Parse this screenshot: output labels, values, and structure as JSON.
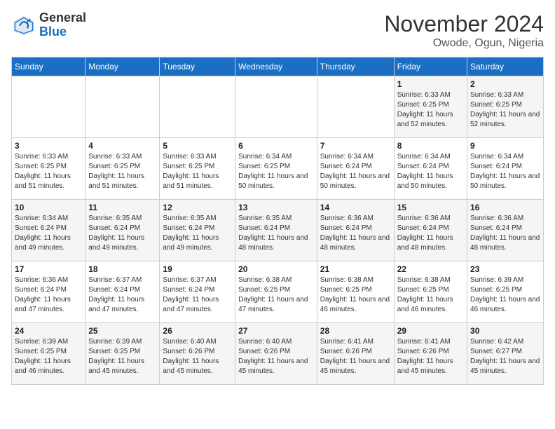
{
  "logo": {
    "general": "General",
    "blue": "Blue"
  },
  "title": "November 2024",
  "location": "Owode, Ogun, Nigeria",
  "days_header": [
    "Sunday",
    "Monday",
    "Tuesday",
    "Wednesday",
    "Thursday",
    "Friday",
    "Saturday"
  ],
  "weeks": [
    [
      {
        "day": "",
        "sunrise": "",
        "sunset": "",
        "daylight": ""
      },
      {
        "day": "",
        "sunrise": "",
        "sunset": "",
        "daylight": ""
      },
      {
        "day": "",
        "sunrise": "",
        "sunset": "",
        "daylight": ""
      },
      {
        "day": "",
        "sunrise": "",
        "sunset": "",
        "daylight": ""
      },
      {
        "day": "",
        "sunrise": "",
        "sunset": "",
        "daylight": ""
      },
      {
        "day": "1",
        "sunrise": "Sunrise: 6:33 AM",
        "sunset": "Sunset: 6:25 PM",
        "daylight": "Daylight: 11 hours and 52 minutes."
      },
      {
        "day": "2",
        "sunrise": "Sunrise: 6:33 AM",
        "sunset": "Sunset: 6:25 PM",
        "daylight": "Daylight: 11 hours and 52 minutes."
      }
    ],
    [
      {
        "day": "3",
        "sunrise": "Sunrise: 6:33 AM",
        "sunset": "Sunset: 6:25 PM",
        "daylight": "Daylight: 11 hours and 51 minutes."
      },
      {
        "day": "4",
        "sunrise": "Sunrise: 6:33 AM",
        "sunset": "Sunset: 6:25 PM",
        "daylight": "Daylight: 11 hours and 51 minutes."
      },
      {
        "day": "5",
        "sunrise": "Sunrise: 6:33 AM",
        "sunset": "Sunset: 6:25 PM",
        "daylight": "Daylight: 11 hours and 51 minutes."
      },
      {
        "day": "6",
        "sunrise": "Sunrise: 6:34 AM",
        "sunset": "Sunset: 6:25 PM",
        "daylight": "Daylight: 11 hours and 50 minutes."
      },
      {
        "day": "7",
        "sunrise": "Sunrise: 6:34 AM",
        "sunset": "Sunset: 6:24 PM",
        "daylight": "Daylight: 11 hours and 50 minutes."
      },
      {
        "day": "8",
        "sunrise": "Sunrise: 6:34 AM",
        "sunset": "Sunset: 6:24 PM",
        "daylight": "Daylight: 11 hours and 50 minutes."
      },
      {
        "day": "9",
        "sunrise": "Sunrise: 6:34 AM",
        "sunset": "Sunset: 6:24 PM",
        "daylight": "Daylight: 11 hours and 50 minutes."
      }
    ],
    [
      {
        "day": "10",
        "sunrise": "Sunrise: 6:34 AM",
        "sunset": "Sunset: 6:24 PM",
        "daylight": "Daylight: 11 hours and 49 minutes."
      },
      {
        "day": "11",
        "sunrise": "Sunrise: 6:35 AM",
        "sunset": "Sunset: 6:24 PM",
        "daylight": "Daylight: 11 hours and 49 minutes."
      },
      {
        "day": "12",
        "sunrise": "Sunrise: 6:35 AM",
        "sunset": "Sunset: 6:24 PM",
        "daylight": "Daylight: 11 hours and 49 minutes."
      },
      {
        "day": "13",
        "sunrise": "Sunrise: 6:35 AM",
        "sunset": "Sunset: 6:24 PM",
        "daylight": "Daylight: 11 hours and 48 minutes."
      },
      {
        "day": "14",
        "sunrise": "Sunrise: 6:36 AM",
        "sunset": "Sunset: 6:24 PM",
        "daylight": "Daylight: 11 hours and 48 minutes."
      },
      {
        "day": "15",
        "sunrise": "Sunrise: 6:36 AM",
        "sunset": "Sunset: 6:24 PM",
        "daylight": "Daylight: 11 hours and 48 minutes."
      },
      {
        "day": "16",
        "sunrise": "Sunrise: 6:36 AM",
        "sunset": "Sunset: 6:24 PM",
        "daylight": "Daylight: 11 hours and 48 minutes."
      }
    ],
    [
      {
        "day": "17",
        "sunrise": "Sunrise: 6:36 AM",
        "sunset": "Sunset: 6:24 PM",
        "daylight": "Daylight: 11 hours and 47 minutes."
      },
      {
        "day": "18",
        "sunrise": "Sunrise: 6:37 AM",
        "sunset": "Sunset: 6:24 PM",
        "daylight": "Daylight: 11 hours and 47 minutes."
      },
      {
        "day": "19",
        "sunrise": "Sunrise: 6:37 AM",
        "sunset": "Sunset: 6:24 PM",
        "daylight": "Daylight: 11 hours and 47 minutes."
      },
      {
        "day": "20",
        "sunrise": "Sunrise: 6:38 AM",
        "sunset": "Sunset: 6:25 PM",
        "daylight": "Daylight: 11 hours and 47 minutes."
      },
      {
        "day": "21",
        "sunrise": "Sunrise: 6:38 AM",
        "sunset": "Sunset: 6:25 PM",
        "daylight": "Daylight: 11 hours and 46 minutes."
      },
      {
        "day": "22",
        "sunrise": "Sunrise: 6:38 AM",
        "sunset": "Sunset: 6:25 PM",
        "daylight": "Daylight: 11 hours and 46 minutes."
      },
      {
        "day": "23",
        "sunrise": "Sunrise: 6:39 AM",
        "sunset": "Sunset: 6:25 PM",
        "daylight": "Daylight: 11 hours and 46 minutes."
      }
    ],
    [
      {
        "day": "24",
        "sunrise": "Sunrise: 6:39 AM",
        "sunset": "Sunset: 6:25 PM",
        "daylight": "Daylight: 11 hours and 46 minutes."
      },
      {
        "day": "25",
        "sunrise": "Sunrise: 6:39 AM",
        "sunset": "Sunset: 6:25 PM",
        "daylight": "Daylight: 11 hours and 45 minutes."
      },
      {
        "day": "26",
        "sunrise": "Sunrise: 6:40 AM",
        "sunset": "Sunset: 6:26 PM",
        "daylight": "Daylight: 11 hours and 45 minutes."
      },
      {
        "day": "27",
        "sunrise": "Sunrise: 6:40 AM",
        "sunset": "Sunset: 6:26 PM",
        "daylight": "Daylight: 11 hours and 45 minutes."
      },
      {
        "day": "28",
        "sunrise": "Sunrise: 6:41 AM",
        "sunset": "Sunset: 6:26 PM",
        "daylight": "Daylight: 11 hours and 45 minutes."
      },
      {
        "day": "29",
        "sunrise": "Sunrise: 6:41 AM",
        "sunset": "Sunset: 6:26 PM",
        "daylight": "Daylight: 11 hours and 45 minutes."
      },
      {
        "day": "30",
        "sunrise": "Sunrise: 6:42 AM",
        "sunset": "Sunset: 6:27 PM",
        "daylight": "Daylight: 11 hours and 45 minutes."
      }
    ]
  ]
}
